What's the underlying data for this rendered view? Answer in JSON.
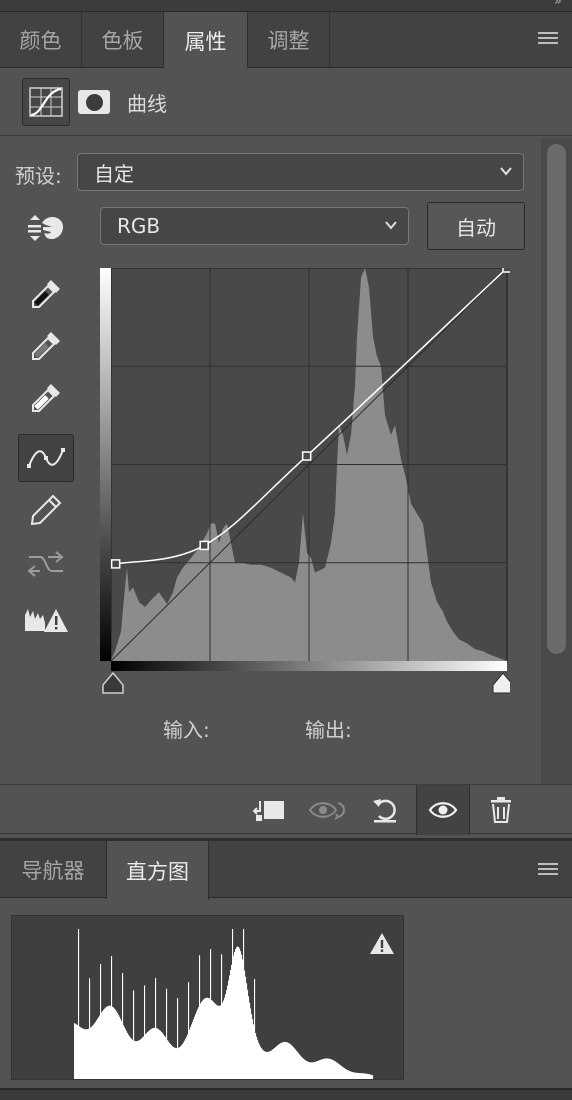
{
  "tabs_top": [
    {
      "label": "颜色",
      "active": false
    },
    {
      "label": "色板",
      "active": false
    },
    {
      "label": "属性",
      "active": true
    },
    {
      "label": "调整",
      "active": false
    }
  ],
  "properties": {
    "title": "曲线",
    "preset_label": "预设:",
    "preset_value": "自定",
    "channel_value": "RGB",
    "auto_button": "自动",
    "input_label": "输入:",
    "output_label": "输出:"
  },
  "curve": {
    "control_points": [
      [
        3,
        63
      ],
      [
        60,
        75
      ],
      [
        126,
        133
      ],
      [
        255,
        255
      ]
    ],
    "range": [
      0,
      255
    ]
  },
  "tabs_bottom": [
    {
      "label": "导航器",
      "active": false
    },
    {
      "label": "直方图",
      "active": true
    }
  ],
  "icons": {
    "curves_adjustment": "curves-adjustment-icon",
    "mask": "mask-icon",
    "on_image_adjust": "hand-drag-icon",
    "black_point": "eyedropper-black-icon",
    "gray_point": "eyedropper-gray-icon",
    "white_point": "eyedropper-white-icon",
    "edit_points": "curve-edit-icon",
    "pencil": "pencil-icon",
    "smooth": "smooth-curve-icon",
    "clipping_warning": "clipping-warning-icon",
    "clip_to_layer": "clip-to-layer-icon",
    "view_previous": "view-previous-icon",
    "reset": "reset-icon",
    "visibility": "eye-icon",
    "delete": "trash-icon",
    "histogram_warning": "warning-triangle-icon",
    "panel_menu": "panel-menu-icon"
  },
  "colors": {
    "panel_bg": "#535353",
    "tab_bg": "#424242",
    "graph_bg": "#494949",
    "histogram_fill": "#8c8c8c",
    "curve": "#ffffff"
  }
}
